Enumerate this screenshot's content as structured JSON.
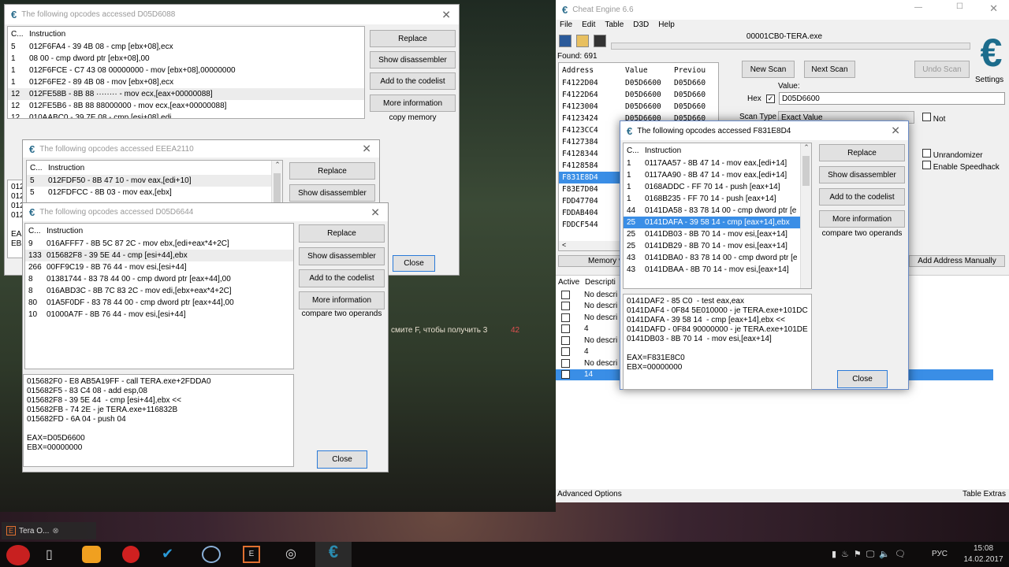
{
  "game": {
    "hint_text": "смите F, чтобы получить 3",
    "hint_count": "42"
  },
  "dialogs": {
    "a": {
      "title": "The following opcodes accessed D05D6088",
      "col_count": "C...",
      "col_instruction": "Instruction",
      "rows": [
        {
          "count": "5",
          "instr": "012F6FA4 - 39 4B 08  - cmp [ebx+08],ecx"
        },
        {
          "count": "1",
          "instr": "08 00 - cmp dword ptr [ebx+08],00"
        },
        {
          "count": "1",
          "instr": "012F6FCE - C7 43 08 00000000 - mov [ebx+08],00000000"
        },
        {
          "count": "1",
          "instr": "012F6FE2 - 89 4B 08  - mov [ebx+08],ecx"
        },
        {
          "count": "12",
          "instr": "012FE58B - 8B 88 ········  - mov ecx,[eax+00000088]"
        },
        {
          "count": "12",
          "instr": "012FE5B6 - 8B 88 88000000  - mov ecx,[eax+00000088]"
        },
        {
          "count": "12",
          "instr": "010AABC0 - 39 7E 08  - cmp [esi+08],edi"
        }
      ],
      "buttons": [
        "Replace",
        "Show disassembler",
        "Add to the codelist",
        "More information"
      ],
      "hint": "copy memory",
      "pane": "012\n012\n012\n012\n\nEAX\nEBX",
      "close": "Close"
    },
    "b": {
      "title": "The following opcodes accessed EEEA2110",
      "col_count": "C...",
      "col_instruction": "Instruction",
      "rows": [
        {
          "count": "5",
          "instr": "012FDF50 - 8B 47 10  - mov eax,[edi+10]"
        },
        {
          "count": "5",
          "instr": "012FDFCC - 8B 03  - mov eax,[ebx]"
        }
      ],
      "buttons": [
        "Replace",
        "Show disassembler"
      ]
    },
    "c": {
      "title": "The following opcodes accessed D05D6644",
      "col_count": "C...",
      "col_instruction": "Instruction",
      "rows": [
        {
          "count": "9",
          "instr": "016AFFF7 - 8B 5C 87 2C  - mov ebx,[edi+eax*4+2C]"
        },
        {
          "count": "133",
          "instr": "015682F8 - 39 5E 44  - cmp [esi+44],ebx"
        },
        {
          "count": "266",
          "instr": "00FF9C19 - 8B 76 44  - mov esi,[esi+44]"
        },
        {
          "count": "8",
          "instr": "01381744 - 83 78 44 00 - cmp dword ptr [eax+44],00"
        },
        {
          "count": "8",
          "instr": "016ABD3C - 8B 7C 83 2C  - mov edi,[ebx+eax*4+2C]"
        },
        {
          "count": "80",
          "instr": "01A5F0DF - 83 78 44 00 - cmp dword ptr [eax+44],00"
        },
        {
          "count": "10",
          "instr": "01000A7F - 8B 76 44  - mov esi,[esi+44]"
        }
      ],
      "buttons": [
        "Replace",
        "Show disassembler",
        "Add to the codelist",
        "More information"
      ],
      "hint": "compare two operands",
      "pane": "015682F0 - E8 AB5A19FF - call TERA.exe+2FDDA0\n015682F5 - 83 C4 08 - add esp,08\n015682F8 - 39 5E 44  - cmp [esi+44],ebx <<\n015682FB - 74 2E - je TERA.exe+116832B\n015682FD - 6A 04 - push 04\n\nEAX=D05D6600\nEBX=00000000",
      "close": "Close"
    },
    "d": {
      "title": "The following opcodes accessed F831E8D4",
      "col_count": "C...",
      "col_instruction": "Instruction",
      "rows": [
        {
          "count": "1",
          "instr": "0117AA57 - 8B 47 14  - mov eax,[edi+14]"
        },
        {
          "count": "1",
          "instr": "0117AA90 - 8B 47 14  - mov eax,[edi+14]"
        },
        {
          "count": "1",
          "instr": "0168ADDC - FF 70 14  - push [eax+14]"
        },
        {
          "count": "1",
          "instr": "0168B235 - FF 70 14  - push [eax+14]"
        },
        {
          "count": "44",
          "instr": "0141DA58 - 83 78 14 00 - cmp dword ptr [e"
        },
        {
          "count": "25",
          "instr": "0141DAFA - 39 58 14  - cmp [eax+14],ebx"
        },
        {
          "count": "25",
          "instr": "0141DB03 - 8B 70 14  - mov esi,[eax+14]"
        },
        {
          "count": "25",
          "instr": "0141DB29 - 8B 70 14  - mov esi,[eax+14]"
        },
        {
          "count": "43",
          "instr": "0141DBA0 - 83 78 14 00 - cmp dword ptr [e"
        },
        {
          "count": "43",
          "instr": "0141DBAA - 8B 70 14  - mov esi,[eax+14]"
        }
      ],
      "buttons": [
        "Replace",
        "Show disassembler",
        "Add to the codelist",
        "More information"
      ],
      "hint": "compare two operands",
      "pane": "0141DAF2 - 85 C0  - test eax,eax\n0141DAF4 - 0F84 5E010000 - je TERA.exe+101DC\n0141DAFA - 39 58 14  - cmp [eax+14],ebx <<\n0141DAFD - 0F84 90000000 - je TERA.exe+101DE\n0141DB03 - 8B 70 14  - mov esi,[eax+14]\n\nEAX=F831E8C0\nEBX=00000000",
      "close": "Close"
    }
  },
  "ce": {
    "title": "Cheat Engine 6.6",
    "menu": [
      "File",
      "Edit",
      "Table",
      "D3D",
      "Help"
    ],
    "process": "00001CB0-TERA.exe",
    "found": "Found: 691",
    "columns": [
      "Address",
      "Value",
      "Previou"
    ],
    "addresses": [
      {
        "addr": "F4122D04",
        "value": "D05D6600",
        "prev": "D05D660"
      },
      {
        "addr": "F4122D64",
        "value": "D05D6600",
        "prev": "D05D660"
      },
      {
        "addr": "F4123004",
        "value": "D05D6600",
        "prev": "D05D660"
      },
      {
        "addr": "F4123424",
        "value": "D05D6600",
        "prev": "D05D660"
      },
      {
        "addr": "F4123CC4",
        "value": "",
        "prev": ""
      },
      {
        "addr": "F4127384",
        "value": "",
        "prev": ""
      },
      {
        "addr": "F4128344",
        "value": "",
        "prev": ""
      },
      {
        "addr": "F4128584",
        "value": "",
        "prev": ""
      },
      {
        "addr": "F831E8D4",
        "value": "",
        "prev": ""
      },
      {
        "addr": "F83E7D04",
        "value": "",
        "prev": ""
      },
      {
        "addr": "FDD47704",
        "value": "",
        "prev": ""
      },
      {
        "addr": "FDDAB404",
        "value": "",
        "prev": ""
      },
      {
        "addr": "FDDCF544",
        "value": "",
        "prev": ""
      }
    ],
    "new_scan": "New Scan",
    "next_scan": "Next Scan",
    "undo_scan": "Undo Scan",
    "settings": "Settings",
    "value_label": "Value:",
    "hex_label": "Hex",
    "hex_checked": true,
    "value": "D05D6600",
    "scan_type_label": "Scan Type",
    "scan_type": "Exact Value",
    "not_label": "Not",
    "unrandomizer": "Unrandomizer",
    "speedhack": "Enable Speedhack",
    "memory_view": "Memory v",
    "add_manual": "Add Address Manually",
    "table_cols": [
      "Active",
      "Descripti"
    ],
    "table_rows": [
      "No descri",
      "No descri",
      "No descri",
      "4",
      "No descri",
      "4",
      "No descri",
      "14"
    ],
    "advanced": "Advanced Options",
    "extras": "Table Extras",
    "accent": "#3a8ee6"
  },
  "taskbar": {
    "preview_label": "Tera O...",
    "lang": "РУС",
    "time": "15:08",
    "date": "14.02.2017"
  }
}
